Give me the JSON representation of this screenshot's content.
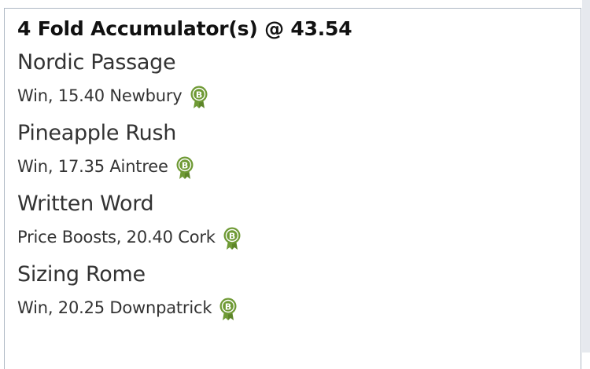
{
  "bet": {
    "title": "4 Fold Accumulator(s) @ 43.54",
    "selections": [
      {
        "name": "Nordic Passage",
        "detail": "Win, 15.40 Newbury",
        "badge_icon": "price-boost-badge-icon",
        "badge_letter": "B"
      },
      {
        "name": "Pineapple Rush",
        "detail": "Win, 17.35 Aintree",
        "badge_icon": "price-boost-badge-icon",
        "badge_letter": "B"
      },
      {
        "name": "Written Word",
        "detail": "Price Boosts, 20.40 Cork",
        "badge_icon": "price-boost-badge-icon",
        "badge_letter": "B"
      },
      {
        "name": "Sizing Rome",
        "detail": "Win, 20.25 Downpatrick",
        "badge_icon": "price-boost-badge-icon",
        "badge_letter": "B"
      }
    ]
  },
  "colors": {
    "badge_green": "#6f9a35",
    "border": "#aeb8c4",
    "text": "#333333",
    "title": "#111111"
  }
}
